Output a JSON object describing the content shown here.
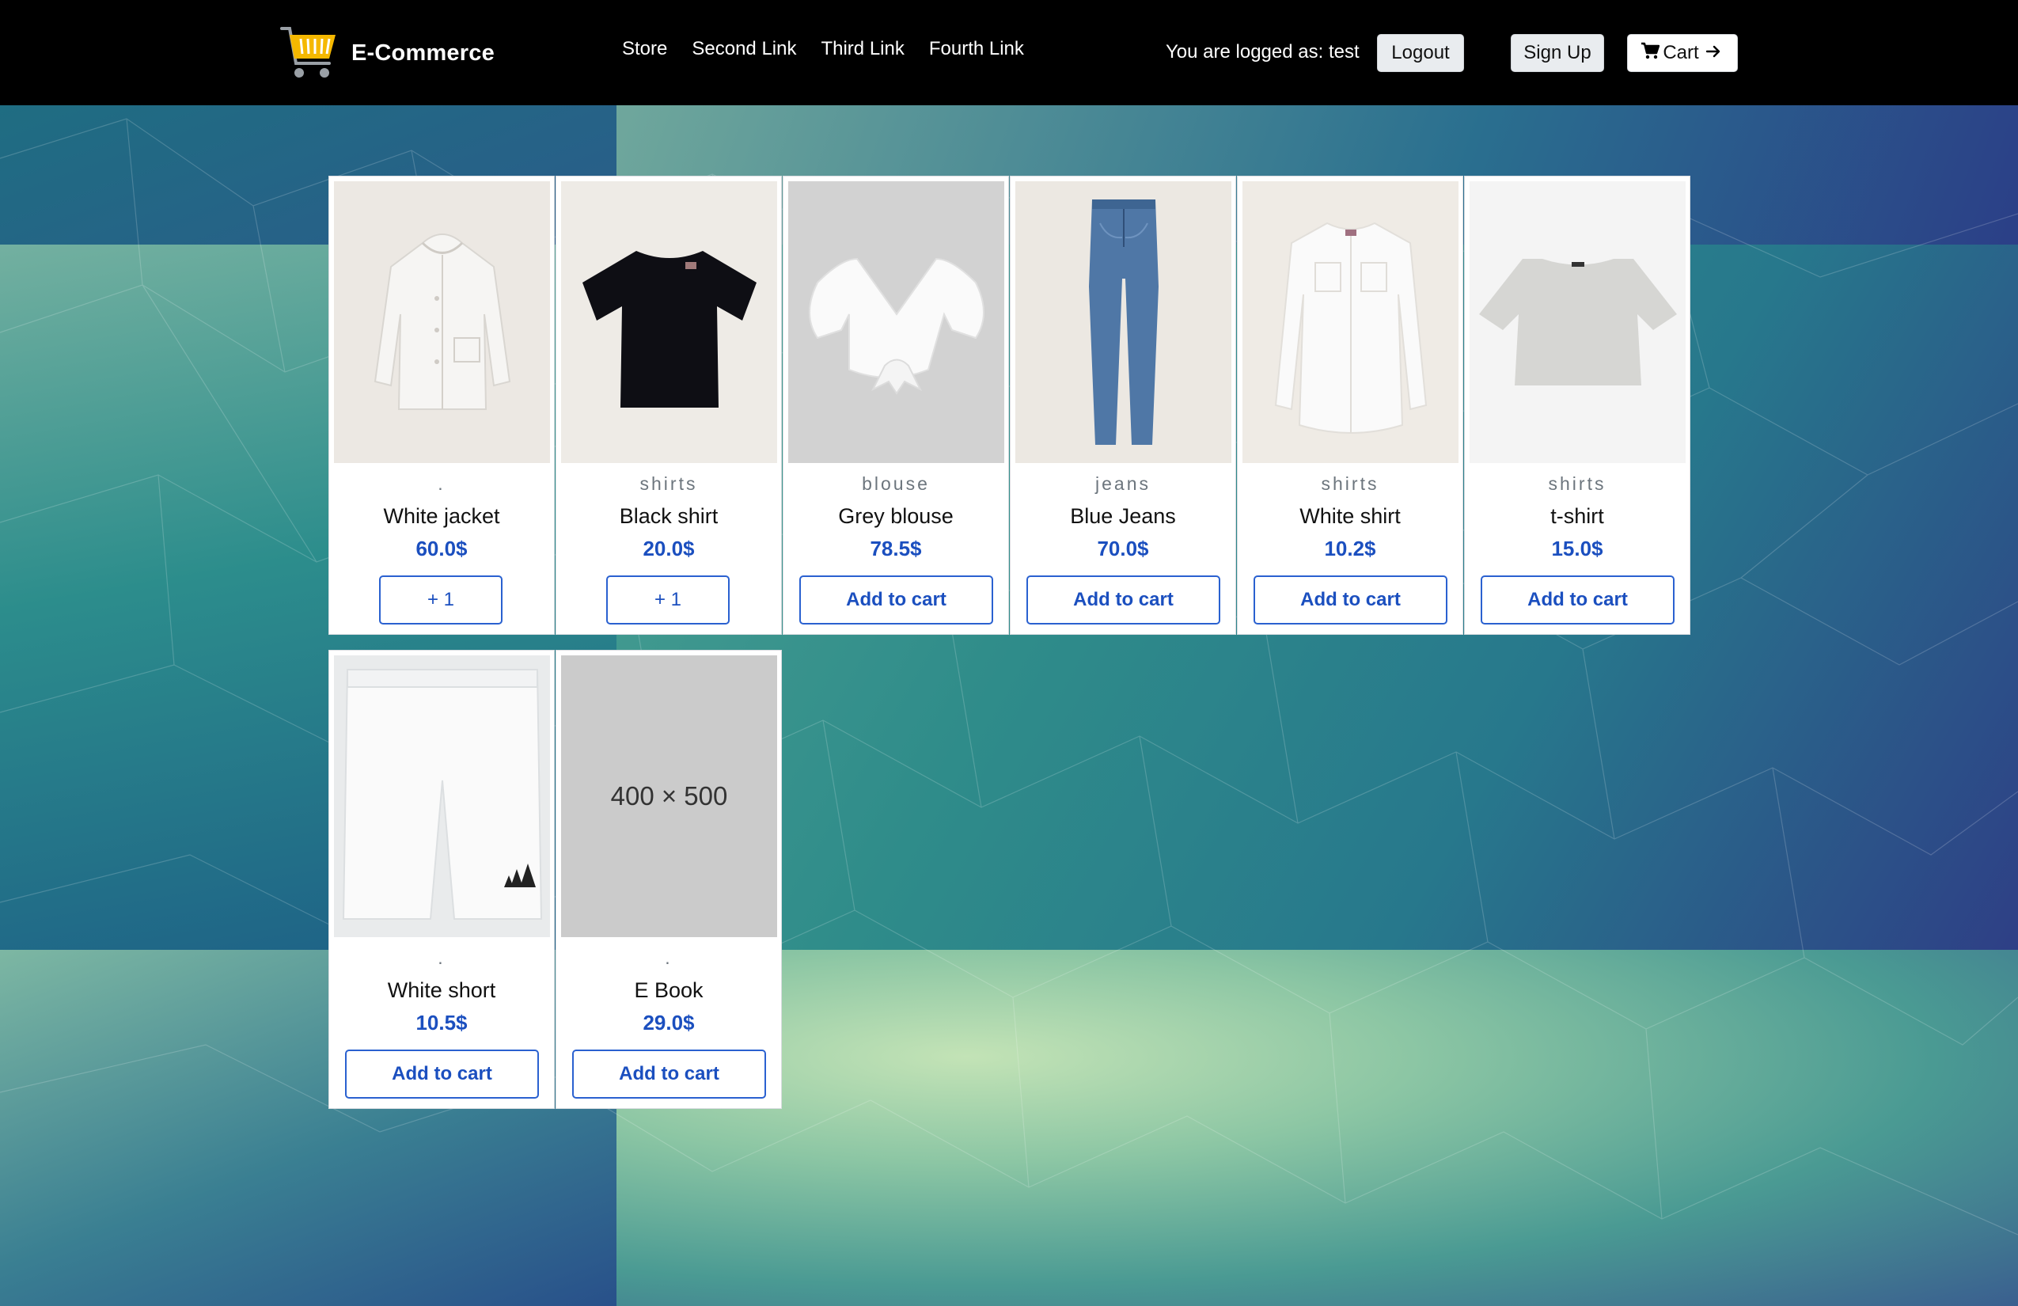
{
  "navbar": {
    "brand": "E-Commerce",
    "links": [
      "Store",
      "Second Link",
      "Third Link",
      "Fourth Link"
    ],
    "login_status": "You are logged as: test",
    "logout_label": "Logout",
    "signup_label": "Sign Up",
    "cart_label": "Cart",
    "colors": {
      "background": "#000000",
      "cart_logo": "#f5b800"
    }
  },
  "products": [
    {
      "category": ".",
      "title": "White jacket",
      "price": "60.0$",
      "button": "+ 1",
      "image": "white-jacket"
    },
    {
      "category": "shirts",
      "title": "Black shirt",
      "price": "20.0$",
      "button": "+ 1",
      "image": "black-shirt"
    },
    {
      "category": "blouse",
      "title": "Grey blouse",
      "price": "78.5$",
      "button": "Add to cart",
      "image": "grey-blouse"
    },
    {
      "category": "jeans",
      "title": "Blue Jeans",
      "price": "70.0$",
      "button": "Add to cart",
      "image": "blue-jeans"
    },
    {
      "category": "shirts",
      "title": "White shirt",
      "price": "10.2$",
      "button": "Add to cart",
      "image": "white-shirt"
    },
    {
      "category": "shirts",
      "title": "t-shirt",
      "price": "15.0$",
      "button": "Add to cart",
      "image": "grey-tshirt"
    },
    {
      "category": ".",
      "title": "White short",
      "price": "10.5$",
      "button": "Add to cart",
      "image": "white-short"
    },
    {
      "category": ".",
      "title": "E Book",
      "price": "29.0$",
      "button": "Add to cart",
      "image": "placeholder",
      "placeholder_text": "400 × 500"
    }
  ],
  "colors": {
    "price": "#1b4fbf",
    "button_border": "#2a61d0"
  }
}
